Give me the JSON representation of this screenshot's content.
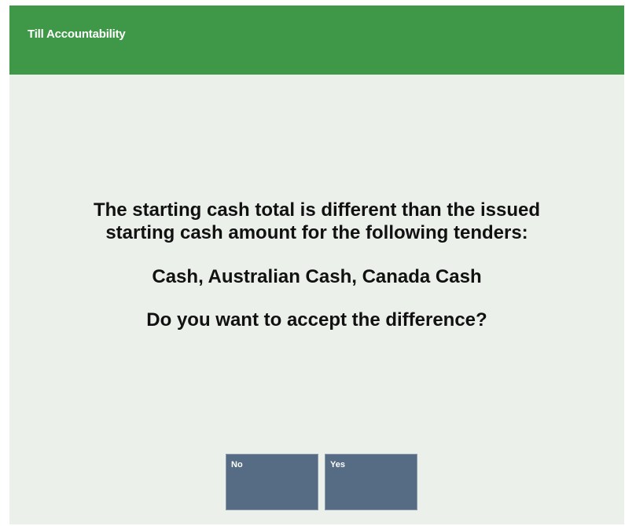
{
  "window": {
    "title": "Till Accountability"
  },
  "message": {
    "line1": "The starting cash total is different than the issued",
    "line2": "starting cash amount for the following tenders:",
    "tenders": "Cash, Australian Cash, Canada Cash",
    "question": "Do you want to accept the difference?"
  },
  "buttons": {
    "no_label": "No",
    "yes_label": "Yes"
  },
  "colors": {
    "title_bar": "#3f9848",
    "background": "#ebf0eb",
    "button": "#556c84"
  }
}
